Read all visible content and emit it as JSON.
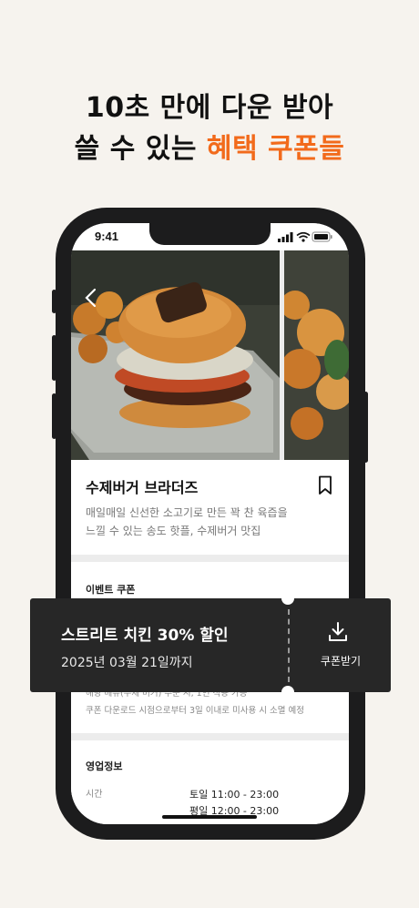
{
  "headline": {
    "line1": "10초 만에 다운 받아",
    "line2_prefix": "쓸 수 있는 ",
    "line2_accent": "혜택 쿠폰들"
  },
  "colors": {
    "accent": "#f26a1b",
    "background": "#f6f3ee",
    "coupon": "#272727"
  },
  "status_bar": {
    "time": "9:41",
    "icons": [
      "signal-icon",
      "wifi-icon",
      "battery-icon"
    ]
  },
  "store": {
    "name": "수제버거 브라더즈",
    "description_line1": "매일매일 신선한 소고기로 만든 꽉 찬 육즙을",
    "description_line2": "느낄 수 있는 송도 핫플, 수제버거 맛집"
  },
  "events": {
    "title": "이벤트 쿠폰",
    "note1": "해당 메뉴(수제 버거) 주문 시, 1인 적용 가능",
    "note2": "쿠폰 다운로드 시점으로부터 3일 이내로 미사용 시 소멸 예정"
  },
  "coupon": {
    "title": "스트리트 치킨 30% 할인",
    "expiry": "2025년 03월 21일까지",
    "download_label": "쿠폰받기"
  },
  "business": {
    "title": "영업정보",
    "time_label": "시간",
    "hours": [
      "토일 11:00 - 23:00",
      "평일 12:00 - 23:00"
    ]
  }
}
